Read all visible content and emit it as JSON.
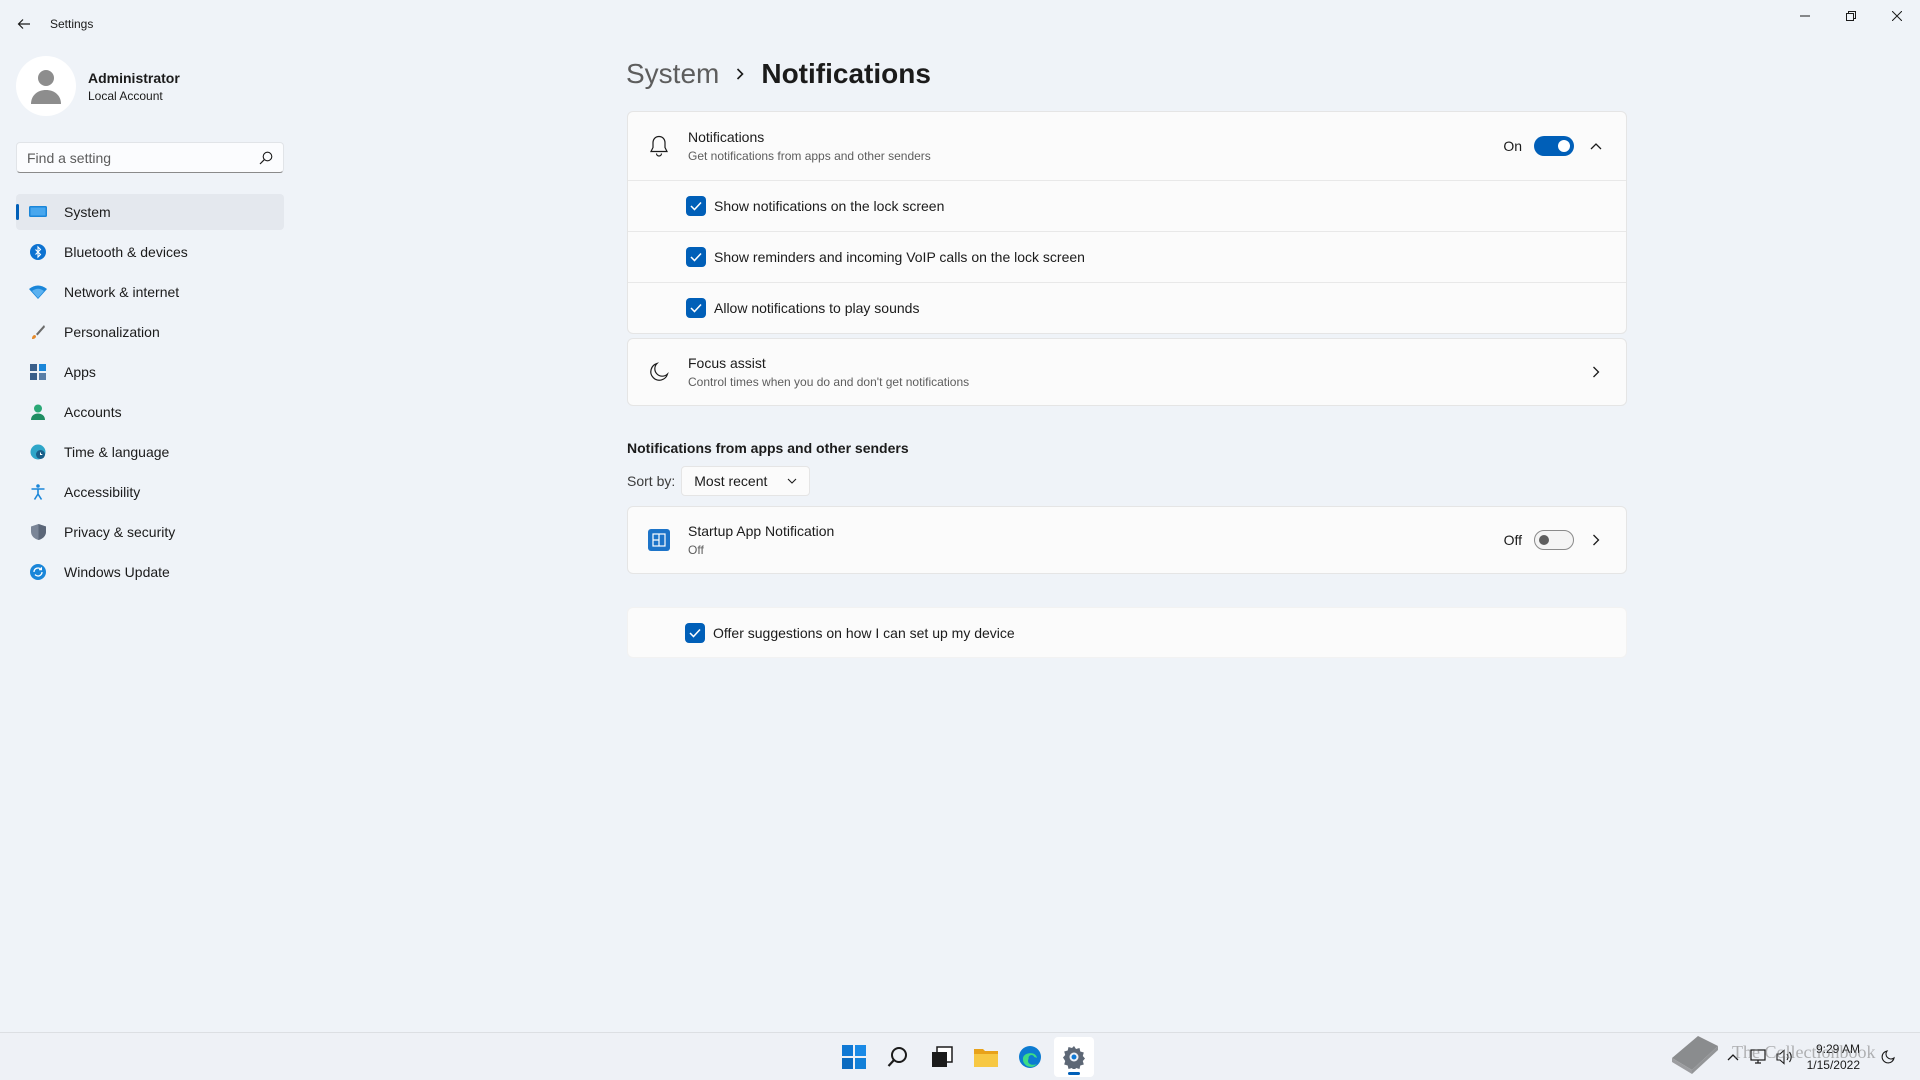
{
  "window": {
    "title": "Settings"
  },
  "profile": {
    "name": "Administrator",
    "account_type": "Local Account"
  },
  "search": {
    "placeholder": "Find a setting"
  },
  "nav": {
    "items": [
      {
        "label": "System",
        "icon": "monitor-icon"
      },
      {
        "label": "Bluetooth & devices",
        "icon": "bluetooth-icon"
      },
      {
        "label": "Network & internet",
        "icon": "wifi-icon"
      },
      {
        "label": "Personalization",
        "icon": "brush-icon"
      },
      {
        "label": "Apps",
        "icon": "apps-icon"
      },
      {
        "label": "Accounts",
        "icon": "person-icon"
      },
      {
        "label": "Time & language",
        "icon": "globe-clock-icon"
      },
      {
        "label": "Accessibility",
        "icon": "accessibility-icon"
      },
      {
        "label": "Privacy & security",
        "icon": "shield-icon"
      },
      {
        "label": "Windows Update",
        "icon": "update-icon"
      }
    ]
  },
  "breadcrumb": {
    "parent": "System",
    "current": "Notifications"
  },
  "notifications_card": {
    "title": "Notifications",
    "subtitle": "Get notifications from apps and other senders",
    "state_label": "On",
    "enabled": true,
    "options": [
      {
        "label": "Show notifications on the lock screen",
        "checked": true
      },
      {
        "label": "Show reminders and incoming VoIP calls on the lock screen",
        "checked": true
      },
      {
        "label": "Allow notifications to play sounds",
        "checked": true
      }
    ]
  },
  "focus_assist": {
    "title": "Focus assist",
    "subtitle": "Control times when you do and don't get notifications"
  },
  "senders_section": {
    "title": "Notifications from apps and other senders",
    "sort_label": "Sort by:",
    "sort_value": "Most recent",
    "apps": [
      {
        "name": "Startup App Notification",
        "status": "Off",
        "state_label": "Off",
        "enabled": false
      }
    ]
  },
  "suggestions": {
    "label": "Offer suggestions on how I can set up my device",
    "checked": true
  },
  "taskbar": {
    "time": "9:29 AM",
    "date": "1/15/2022"
  },
  "watermark": {
    "text": "The Collectionbook"
  },
  "colors": {
    "accent": "#005fb8",
    "background": "#eff3f8",
    "card": "#fbfbfb"
  }
}
